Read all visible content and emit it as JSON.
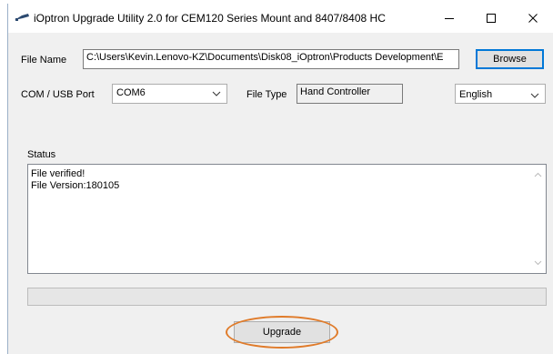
{
  "window": {
    "title": "iOptron Upgrade Utility 2.0 for CEM120 Series Mount and 8407/8408 HC",
    "app_icon": "telescope-icon",
    "controls": [
      "minimize-icon",
      "maximize-icon",
      "close-icon"
    ]
  },
  "file": {
    "label": "File Name",
    "path": "C:\\Users\\Kevin.Lenovo-KZ\\Documents\\Disk08_iOptron\\Products Development\\E",
    "browse_label": "Browse"
  },
  "port": {
    "label": "COM / USB Port",
    "selected": "COM6"
  },
  "file_type": {
    "label": "File Type",
    "value": "Hand Controller"
  },
  "language": {
    "selected": "English"
  },
  "status": {
    "label": "Status",
    "lines": [
      "File verified!",
      "File Version:180105"
    ]
  },
  "progress": {
    "value": 0
  },
  "upgrade": {
    "label": "Upgrade"
  },
  "colors": {
    "highlight_ring": "#e07b2a",
    "default_button_border": "#0078d7"
  }
}
